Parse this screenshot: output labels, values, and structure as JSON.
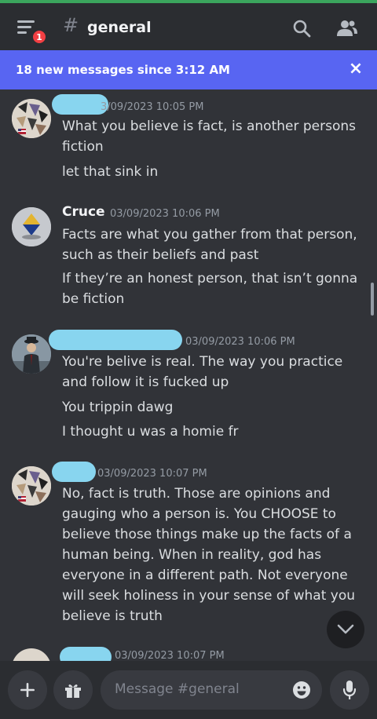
{
  "header": {
    "notification_count": "1",
    "channel_hash": "#",
    "channel_name": "general"
  },
  "banner": {
    "text": "18 new messages since 3:12 AM",
    "close": "×"
  },
  "messages": [
    {
      "author": "",
      "timestamp": "3/09/2023 10:05 PM",
      "lines": [
        "What you believe is fact, is another persons fiction",
        "let that sink in"
      ]
    },
    {
      "author": "Cruce",
      "timestamp": "03/09/2023 10:06 PM",
      "lines": [
        "Facts are what you gather from that person, such as their beliefs and past",
        "If they’re an honest person, that isn’t gonna be fiction"
      ]
    },
    {
      "author": "",
      "timestamp": "03/09/2023 10:06 PM",
      "lines": [
        "You're belive is real. The way you practice and follow it is fucked up",
        "You trippin dawg",
        "I thought u was a homie fr"
      ]
    },
    {
      "author": "",
      "timestamp": "03/09/2023 10:07 PM",
      "lines": [
        "No, fact is truth. Those are opinions and gauging who a person is. You CHOOSE to believe those things make up the facts of a human being. When in reality, god has everyone in a different path. Not everyone will seek holiness in your sense of what you believe is truth"
      ]
    },
    {
      "author": "",
      "timestamp": "03/09/2023 10:07 PM",
      "lines": []
    }
  ],
  "composer": {
    "placeholder": "Message #general"
  },
  "colors": {
    "background": "#313338",
    "header": "#2b2d31",
    "banner": "#5865f2",
    "badge": "#f23f43",
    "name_redaction": "#88d5ef"
  }
}
